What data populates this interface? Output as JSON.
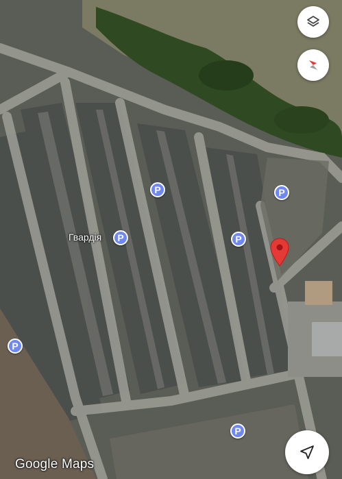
{
  "map": {
    "place_label": "Гвардія",
    "watermark": "Google Maps",
    "parking_glyph": "P",
    "parking_markers": [
      "parking-icon",
      "parking-icon",
      "parking-icon",
      "parking-icon",
      "parking-icon",
      "parking-icon",
      "parking-icon"
    ]
  },
  "controls": {
    "layers_icon": "layers-icon",
    "compass_icon": "compass-icon",
    "my_location_icon": "navigation-arrow-icon"
  },
  "colors": {
    "parking": "#6f88f3",
    "pin": "#e53935",
    "road": "#9a9a93",
    "vegetation": "#2f4a22"
  }
}
